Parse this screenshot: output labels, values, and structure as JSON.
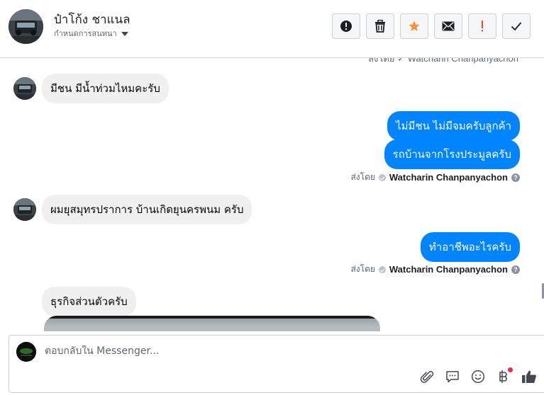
{
  "header": {
    "name": "ป๋าโก้ง ชาแนล",
    "assign_label": "กำหนดการสนทนา",
    "actions": [
      "spam",
      "delete",
      "star",
      "mark-unread",
      "important",
      "done"
    ]
  },
  "conversation": {
    "top_seen_fragment": "ส่งโดย ✓ Watcharin Chanpanyachon",
    "messages": [
      {
        "direction": "in",
        "text": "มีชน มีน้ำท่วมไหมคะรับ"
      },
      {
        "direction": "out",
        "text": "ไม่มีชน ไม่มีจมครับลูกค้า"
      },
      {
        "direction": "out",
        "text": "รถบ้านจากโรงประมูลครับ"
      },
      {
        "direction": "in",
        "text": "ผมยุสมุทรปราการ บ้านเกิดยุนครพนม ครับ"
      },
      {
        "direction": "out",
        "text": "ทำอาชีพอะไรครับ"
      },
      {
        "direction": "in",
        "text": "ธุรกิจส่วนตัวครับ"
      }
    ],
    "sent_by_prefix": "ส่งโดย",
    "sent_by_name": "Watcharin Chanpanyachon",
    "help_glyph": "?"
  },
  "composer": {
    "placeholder": "ตอบกลับใน Messenger..."
  },
  "composer_icons": [
    "paperclip-icon",
    "saved-replies-icon",
    "emoji-icon",
    "payment-icon",
    "thumbs-up-icon"
  ],
  "colors": {
    "accent": "#0084ff",
    "star": "#f7923b",
    "important": "#fa3e3e",
    "bubble_in": "#f0f0f0"
  }
}
